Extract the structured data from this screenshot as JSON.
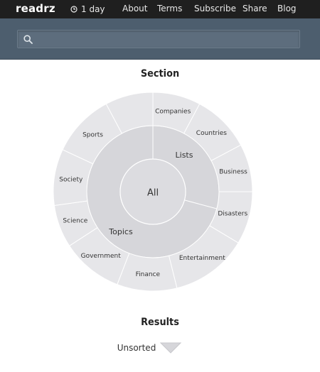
{
  "app": {
    "brand": "readrz"
  },
  "nav": {
    "time_filter": "1 day",
    "links": [
      "About",
      "Terms",
      "Subscribe",
      "Share",
      "Blog"
    ]
  },
  "search": {
    "value": "",
    "placeholder": ""
  },
  "section": {
    "heading": "Section",
    "core": "All",
    "middle": [
      "Lists",
      "Topics"
    ],
    "outer_lists": [
      "Companies",
      "Countries",
      "Business",
      "Disasters"
    ],
    "outer_topics": [
      "Entertainment",
      "Finance",
      "Government",
      "Science",
      "Society",
      "Sports"
    ]
  },
  "results": {
    "heading": "Results",
    "sort_label": "Unsorted"
  },
  "colors": {
    "topbar": "#1f1f1f",
    "search_band": "#4d5e6e",
    "segment_outer": "#e6e6e9",
    "segment_middle": "#d6d6da"
  }
}
